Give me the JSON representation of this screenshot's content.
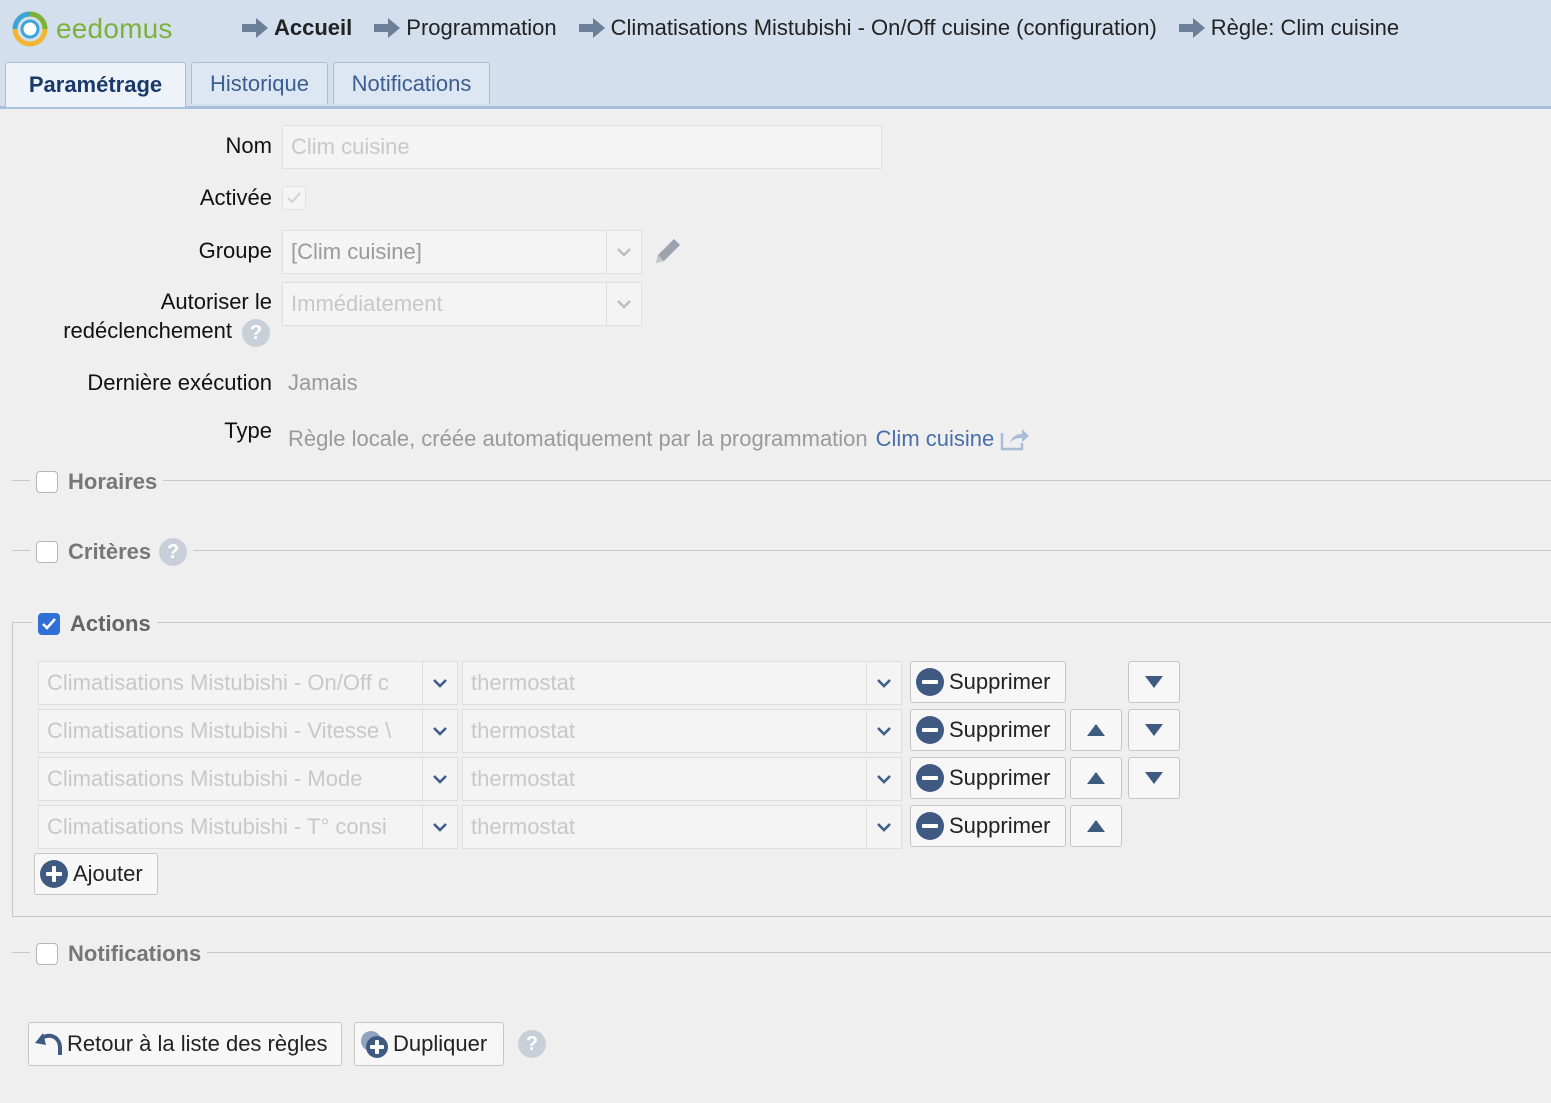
{
  "header": {
    "logo_text": "eedomus",
    "breadcrumbs": [
      {
        "label": "Accueil"
      },
      {
        "label": "Programmation"
      },
      {
        "label": "Climatisations Mistubishi - On/Off cuisine (configuration)"
      },
      {
        "label": "Règle: Clim cuisine"
      }
    ]
  },
  "tabs": [
    {
      "label": "Paramétrage",
      "active": true
    },
    {
      "label": "Historique",
      "active": false
    },
    {
      "label": "Notifications",
      "active": false
    }
  ],
  "form": {
    "nom_label": "Nom",
    "nom_value": "Clim cuisine",
    "activee_label": "Activée",
    "groupe_label": "Groupe",
    "groupe_value": "[Clim cuisine]",
    "redecl_label_1": "Autoriser le",
    "redecl_label_2": "redéclenchement",
    "redecl_value": "Immédiatement",
    "derniere_label": "Dernière exécution",
    "derniere_value": "Jamais",
    "type_label": "Type",
    "type_value": "Règle locale, créée automatiquement par la programmation",
    "type_link": "Clim cuisine",
    "help_glyph": "?"
  },
  "sections": {
    "horaires": "Horaires",
    "criteres": "Critères",
    "actions": "Actions",
    "notifications": "Notifications"
  },
  "actions": [
    {
      "device": "Climatisations Mistubishi - On/Off c",
      "value": "thermostat",
      "delete_label": "Supprimer"
    },
    {
      "device": "Climatisations Mistubishi - Vitesse \\",
      "value": "thermostat",
      "delete_label": "Supprimer"
    },
    {
      "device": "Climatisations Mistubishi - Mode",
      "value": "thermostat",
      "delete_label": "Supprimer"
    },
    {
      "device": "Climatisations Mistubishi - T° consi",
      "value": "thermostat",
      "delete_label": "Supprimer"
    }
  ],
  "buttons": {
    "add_label": "Ajouter",
    "back_label": "Retour à la liste des règles",
    "duplicate_label": "Dupliquer"
  },
  "colors": {
    "header_bg": "#d4dfee",
    "link": "#4a6fa8",
    "checkbox_blue": "#2f6fd6"
  }
}
